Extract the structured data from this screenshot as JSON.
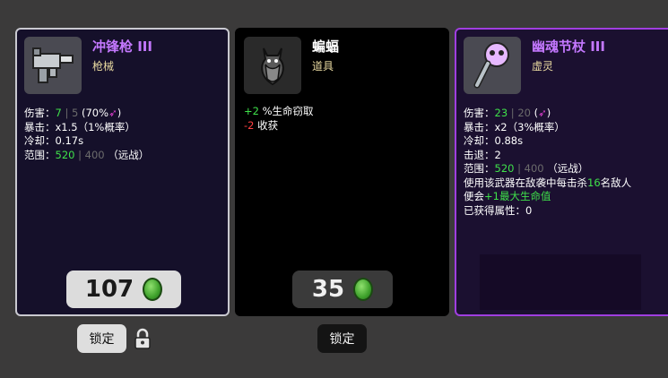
{
  "cards": [
    {
      "name": "冲锋枪 III",
      "type": "枪械",
      "name_color": "#c478ff",
      "stats": {
        "damage_label": "伤害：",
        "damage_main": "7",
        "damage_sep": "|",
        "damage_alt": "5",
        "damage_extra": "(70%",
        "damage_close": ")",
        "crit_label": "暴击：",
        "crit_value": "x1.5（1%概率）",
        "cooldown_label": "冷却：",
        "cooldown_value": "0.17s",
        "range_label": "范围：",
        "range_main": "520",
        "range_sep": "|",
        "range_alt": "400",
        "range_extra": "（远战）"
      },
      "price": "107",
      "lock_label": "锁定"
    },
    {
      "name": "蝙蝠",
      "type": "道具",
      "name_color": "#ffffff",
      "effects": [
        {
          "value": "+2",
          "text": " %生命窃取",
          "color": "#3fe04a"
        },
        {
          "value": "-2",
          "text": " 收获",
          "color": "#ff4040"
        }
      ],
      "price": "35",
      "lock_label": "锁定"
    },
    {
      "name": "幽魂节杖 III",
      "type": "虚灵",
      "name_color": "#c478ff",
      "stats": {
        "damage_label": "伤害：",
        "damage_main": "23",
        "damage_sep": "|",
        "damage_alt": "20",
        "damage_extra": "(",
        "damage_close": ")",
        "crit_label": "暴击：",
        "crit_value": "x2（3%概率）",
        "cooldown_label": "冷却：",
        "cooldown_value": "0.88s",
        "knockback_label": "击退：",
        "knockback_value": "2",
        "range_label": "范围：",
        "range_main": "520",
        "range_sep": "|",
        "range_alt": "400",
        "range_extra": "（远战）"
      },
      "desc_1a": "使用该武器在敌袭中每击杀",
      "desc_1b": "16",
      "desc_1c": "名敌人",
      "desc_2a": "便会",
      "desc_2b": "+1最大生命值",
      "desc_3": "已获得属性：0"
    }
  ],
  "colors": {
    "green": "#3fe04a",
    "purple_border": "#a03ee0",
    "grey_border": "#c9c9d0"
  }
}
